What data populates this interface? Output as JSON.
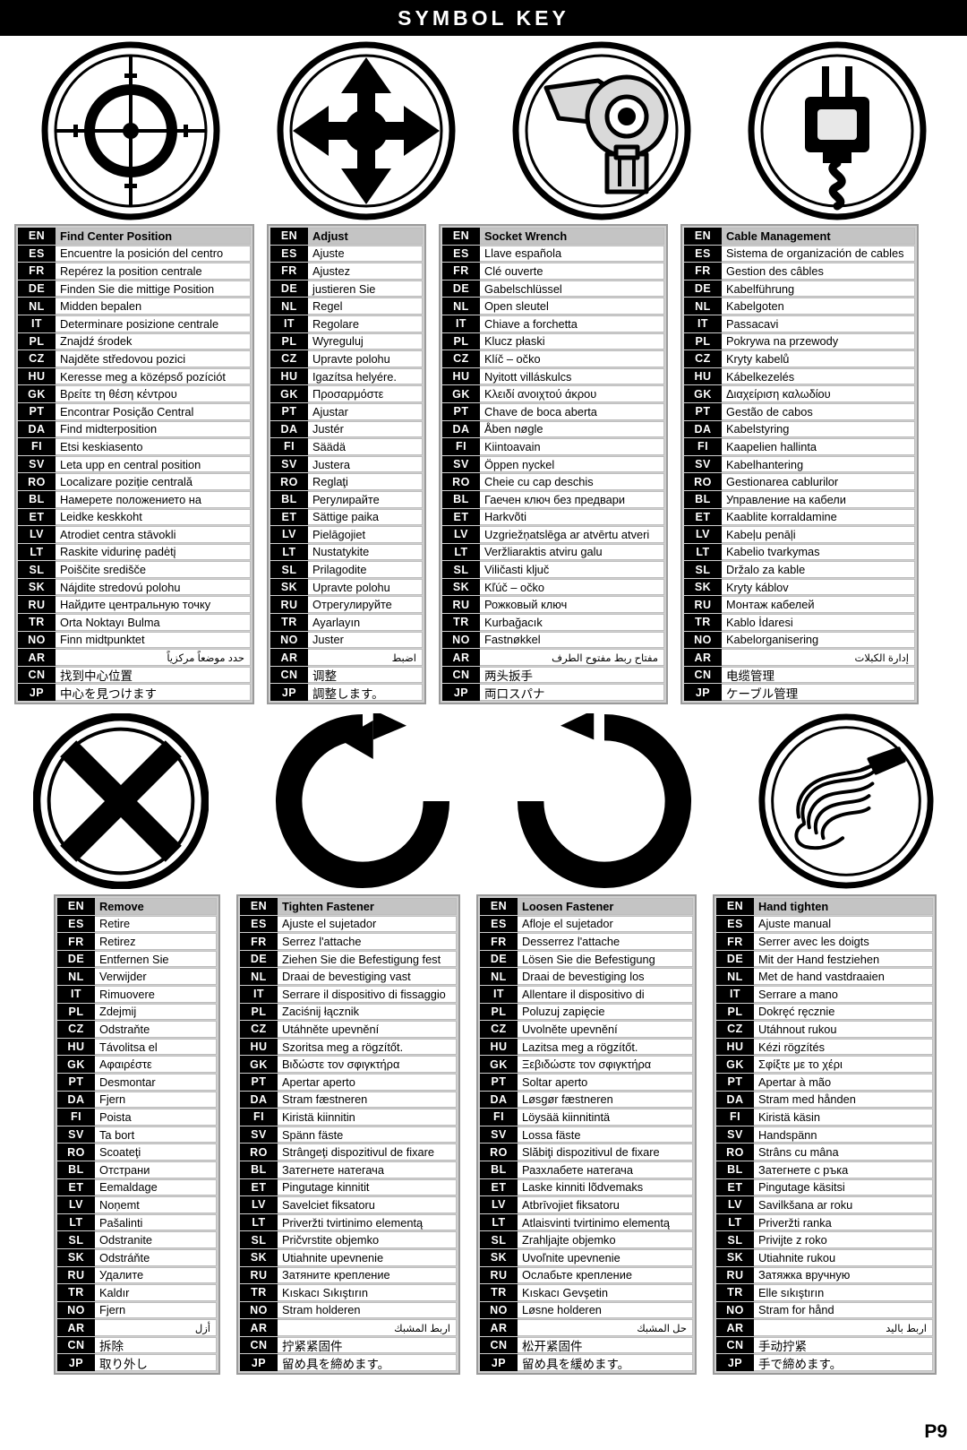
{
  "header": {
    "title": "SYMBOL KEY"
  },
  "page_number": "P9",
  "symbols_top": [
    {
      "name": "find-center-position-symbol",
      "icon": "crosshair-target-icon"
    },
    {
      "name": "adjust-symbol",
      "icon": "four-way-arrows-icon"
    },
    {
      "name": "socket-wrench-symbol",
      "icon": "ratchet-wrench-icon"
    },
    {
      "name": "cable-management-symbol",
      "icon": "power-plug-icon"
    }
  ],
  "symbols_bottom": [
    {
      "name": "remove-symbol",
      "icon": "x-cross-icon"
    },
    {
      "name": "tighten-fastener-symbol",
      "icon": "clockwise-arrow-icon"
    },
    {
      "name": "loosen-fastener-symbol",
      "icon": "counterclockwise-arrow-icon"
    },
    {
      "name": "hand-tighten-symbol",
      "icon": "hand-screwdriver-icon"
    }
  ],
  "tables_top": [
    {
      "id": "find-center-position",
      "rows": [
        {
          "code": "EN",
          "text": "Find Center Position"
        },
        {
          "code": "ES",
          "text": "Encuentre la posición del centro"
        },
        {
          "code": "FR",
          "text": "Repérez la position centrale"
        },
        {
          "code": "DE",
          "text": "Finden Sie die mittige Position"
        },
        {
          "code": "NL",
          "text": "Midden bepalen"
        },
        {
          "code": "IT",
          "text": "Determinare posizione centrale"
        },
        {
          "code": "PL",
          "text": "Znajdź środek"
        },
        {
          "code": "CZ",
          "text": "Najděte středovou pozici"
        },
        {
          "code": "HU",
          "text": "Keresse meg a középső pozíciót"
        },
        {
          "code": "GK",
          "text": "Βρείτε τη θέση κέντρου"
        },
        {
          "code": "PT",
          "text": "Encontrar Posição Central"
        },
        {
          "code": "DA",
          "text": "Find midterposition"
        },
        {
          "code": "FI",
          "text": "Etsi keskiasento"
        },
        {
          "code": "SV",
          "text": "Leta upp en central position"
        },
        {
          "code": "RO",
          "text": " Localizare poziție centrală"
        },
        {
          "code": "BL",
          "text": "Намерете положението на"
        },
        {
          "code": "ET",
          "text": "Leidke keskkoht"
        },
        {
          "code": "LV",
          "text": "Atrodiet centra stāvokli"
        },
        {
          "code": "LT",
          "text": "Raskite vidurinę padėtį"
        },
        {
          "code": "SL",
          "text": "Poiščite središče"
        },
        {
          "code": "SK",
          "text": "Nájdite stredovú polohu"
        },
        {
          "code": "RU",
          "text": "Найдите центральную точку"
        },
        {
          "code": "TR",
          "text": "Orta Noktayı Bulma"
        },
        {
          "code": "NO",
          "text": "Finn midtpunktet"
        },
        {
          "code": "AR",
          "text": "حدد موضعاً مركزياً"
        },
        {
          "code": "CN",
          "text": "找到中心位置"
        },
        {
          "code": "JP",
          "text": "中心を見つけます"
        }
      ]
    },
    {
      "id": "adjust",
      "rows": [
        {
          "code": "EN",
          "text": "Adjust"
        },
        {
          "code": "ES",
          "text": "Ajuste"
        },
        {
          "code": "FR",
          "text": "Ajustez"
        },
        {
          "code": "DE",
          "text": "justieren Sie"
        },
        {
          "code": "NL",
          "text": "Regel"
        },
        {
          "code": "IT",
          "text": "Regolare"
        },
        {
          "code": "PL",
          "text": "Wyreguluj"
        },
        {
          "code": "CZ",
          "text": "Upravte polohu"
        },
        {
          "code": "HU",
          "text": "Igazítsa helyére."
        },
        {
          "code": "GK",
          "text": "Προσαρμόστε"
        },
        {
          "code": "PT",
          "text": "Ajustar"
        },
        {
          "code": "DA",
          "text": "Justér"
        },
        {
          "code": "FI",
          "text": "Säädä"
        },
        {
          "code": "SV",
          "text": "Justera"
        },
        {
          "code": "RO",
          "text": "Reglaţi"
        },
        {
          "code": "BL",
          "text": "Регулирайте"
        },
        {
          "code": "ET",
          "text": "Sättige paika"
        },
        {
          "code": "LV",
          "text": "Pielāgojiet"
        },
        {
          "code": "LT",
          "text": "Nustatykite"
        },
        {
          "code": "SL",
          "text": "Prilagodite"
        },
        {
          "code": "SK",
          "text": "Upravte polohu"
        },
        {
          "code": "RU",
          "text": "Отрегулируйте"
        },
        {
          "code": "TR",
          "text": "Ayarlayın"
        },
        {
          "code": "NO",
          "text": "Juster"
        },
        {
          "code": "AR",
          "text": "اضبط"
        },
        {
          "code": "CN",
          "text": "调整"
        },
        {
          "code": "JP",
          "text": "調整します。"
        }
      ]
    },
    {
      "id": "socket-wrench",
      "rows": [
        {
          "code": "EN",
          "text": "Socket Wrench"
        },
        {
          "code": "ES",
          "text": "Llave española"
        },
        {
          "code": "FR",
          "text": "Clé ouverte"
        },
        {
          "code": "DE",
          "text": "Gabelschlüssel"
        },
        {
          "code": "NL",
          "text": "Open sleutel"
        },
        {
          "code": "IT",
          "text": "Chiave a forchetta"
        },
        {
          "code": "PL",
          "text": "Klucz płaski"
        },
        {
          "code": "CZ",
          "text": "Klíč – očko"
        },
        {
          "code": "HU",
          "text": "Nyitott villáskulcs"
        },
        {
          "code": "GK",
          "text": "Κλειδί ανοιχτού άκρου"
        },
        {
          "code": "PT",
          "text": "Chave de boca aberta"
        },
        {
          "code": "DA",
          "text": "Åben nøgle"
        },
        {
          "code": "FI",
          "text": "Kiintoavain"
        },
        {
          "code": "SV",
          "text": "Öppen nyckel"
        },
        {
          "code": "RO",
          "text": "Cheie cu cap deschis"
        },
        {
          "code": "BL",
          "text": "Гаечен ключ без предвари"
        },
        {
          "code": "ET",
          "text": "Harkvõti"
        },
        {
          "code": "LV",
          "text": "Uzgriežņatslēga ar atvērtu atveri"
        },
        {
          "code": "LT",
          "text": "Veržliaraktis atviru galu"
        },
        {
          "code": "SL",
          "text": "Viličasti ključ"
        },
        {
          "code": "SK",
          "text": "Kľúč – očko"
        },
        {
          "code": "RU",
          "text": "Рожковый ключ"
        },
        {
          "code": "TR",
          "text": "Kurbağacık"
        },
        {
          "code": "NO",
          "text": "Fastnøkkel"
        },
        {
          "code": "AR",
          "text": "مفتاح ربط مفتوح الطرف"
        },
        {
          "code": "CN",
          "text": "两头扳手"
        },
        {
          "code": "JP",
          "text": "両口スパナ"
        }
      ]
    },
    {
      "id": "cable-management",
      "rows": [
        {
          "code": "EN",
          "text": "Cable Management"
        },
        {
          "code": "ES",
          "text": "Sistema de organización de cables"
        },
        {
          "code": "FR",
          "text": "Gestion des câbles"
        },
        {
          "code": "DE",
          "text": "Kabelführung"
        },
        {
          "code": "NL",
          "text": "Kabelgoten"
        },
        {
          "code": "IT",
          "text": "Passacavi"
        },
        {
          "code": "PL",
          "text": "Pokrywa na przewody"
        },
        {
          "code": "CZ",
          "text": "Kryty kabelů"
        },
        {
          "code": "HU",
          "text": "Kábelkezelés"
        },
        {
          "code": "GK",
          "text": "Διαχείριση καλωδίου"
        },
        {
          "code": "PT",
          "text": "Gestão de cabos"
        },
        {
          "code": "DA",
          "text": "Kabelstyring"
        },
        {
          "code": "FI",
          "text": "Kaapelien hallinta"
        },
        {
          "code": "SV",
          "text": "Kabelhantering"
        },
        {
          "code": "RO",
          "text": "Gestionarea cablurilor"
        },
        {
          "code": "BL",
          "text": "Управление на кабели"
        },
        {
          "code": "ET",
          "text": "Kaablite korraldamine"
        },
        {
          "code": "LV",
          "text": "Kabeļu penāļi"
        },
        {
          "code": "LT",
          "text": "Kabelio tvarkymas"
        },
        {
          "code": "SL",
          "text": "Držalo za kable"
        },
        {
          "code": "SK",
          "text": "Kryty káblov"
        },
        {
          "code": "RU",
          "text": "Монтаж кабелей"
        },
        {
          "code": "TR",
          "text": "Kablo İdaresi"
        },
        {
          "code": "NO",
          "text": "Kabelorganisering"
        },
        {
          "code": "AR",
          "text": "إدارة الكبلات"
        },
        {
          "code": "CN",
          "text": "电缆管理"
        },
        {
          "code": "JP",
          "text": "ケーブル管理"
        }
      ]
    }
  ],
  "tables_bottom": [
    {
      "id": "remove",
      "rows": [
        {
          "code": "EN",
          "text": "Remove"
        },
        {
          "code": "ES",
          "text": "Retire"
        },
        {
          "code": "FR",
          "text": "Retirez"
        },
        {
          "code": "DE",
          "text": "Entfernen Sie"
        },
        {
          "code": "NL",
          "text": "Verwijder"
        },
        {
          "code": "IT",
          "text": "Rimuovere"
        },
        {
          "code": "PL",
          "text": "Zdejmij"
        },
        {
          "code": "CZ",
          "text": "Odstraňte"
        },
        {
          "code": "HU",
          "text": "Távolitsa el"
        },
        {
          "code": "GK",
          "text": "Αφαιρέστε"
        },
        {
          "code": "PT",
          "text": "Desmontar"
        },
        {
          "code": "DA",
          "text": "Fjern"
        },
        {
          "code": "FI",
          "text": "Poista"
        },
        {
          "code": "SV",
          "text": "Ta bort"
        },
        {
          "code": "RO",
          "text": "Scoateţi"
        },
        {
          "code": "BL",
          "text": "Отстрани"
        },
        {
          "code": "ET",
          "text": "Eemaldage"
        },
        {
          "code": "LV",
          "text": "Noņemt"
        },
        {
          "code": "LT",
          "text": "Pašalinti"
        },
        {
          "code": "SL",
          "text": "Odstranite"
        },
        {
          "code": "SK",
          "text": "Odstráňte"
        },
        {
          "code": "RU",
          "text": "Удалите"
        },
        {
          "code": "TR",
          "text": "Kaldır"
        },
        {
          "code": "NO",
          "text": "Fjern"
        },
        {
          "code": "AR",
          "text": "أزل"
        },
        {
          "code": "CN",
          "text": "拆除"
        },
        {
          "code": "JP",
          "text": "取り外し"
        }
      ]
    },
    {
      "id": "tighten-fastener",
      "rows": [
        {
          "code": "EN",
          "text": "Tighten Fastener"
        },
        {
          "code": "ES",
          "text": "Ajuste el sujetador"
        },
        {
          "code": "FR",
          "text": "Serrez l'attache"
        },
        {
          "code": "DE",
          "text": "Ziehen Sie die Befestigung fest"
        },
        {
          "code": "NL",
          "text": "Draai de bevestiging vast"
        },
        {
          "code": "IT",
          "text": "Serrare il dispositivo di fissaggio"
        },
        {
          "code": "PL",
          "text": "Zaciśnij łącznik"
        },
        {
          "code": "CZ",
          "text": "Utáhněte upevnění"
        },
        {
          "code": "HU",
          "text": "Szoritsa meg a rögzítőt."
        },
        {
          "code": "GK",
          "text": "Βιδώστε τον σφιγκτήρα"
        },
        {
          "code": "PT",
          "text": "Apertar aperto"
        },
        {
          "code": "DA",
          "text": "Stram fæstneren"
        },
        {
          "code": "FI",
          "text": "Kiristä kiinnitin"
        },
        {
          "code": "SV",
          "text": "Spänn fäste"
        },
        {
          "code": "RO",
          "text": "Strângeţi dispozitivul de fixare"
        },
        {
          "code": "BL",
          "text": "Затегнете натегача"
        },
        {
          "code": "ET",
          "text": "Pingutage kinnitit"
        },
        {
          "code": "LV",
          "text": "Savelciet fiksatoru"
        },
        {
          "code": "LT",
          "text": "Priveržti tvirtinimo elementą"
        },
        {
          "code": "SL",
          "text": "Pričvrstite objemko"
        },
        {
          "code": "SK",
          "text": "Utiahnite upevnenie"
        },
        {
          "code": "RU",
          "text": "Затяните крепление"
        },
        {
          "code": "TR",
          "text": "Kıskacı Sıkıştırın"
        },
        {
          "code": "NO",
          "text": "Stram holderen"
        },
        {
          "code": "AR",
          "text": "اربط المشبك"
        },
        {
          "code": "CN",
          "text": "拧紧紧固件"
        },
        {
          "code": "JP",
          "text": "留め具を締めます。"
        }
      ]
    },
    {
      "id": "loosen-fastener",
      "rows": [
        {
          "code": "EN",
          "text": "Loosen Fastener"
        },
        {
          "code": "ES",
          "text": "Afloje el sujetador"
        },
        {
          "code": "FR",
          "text": "Desserrez l'attache"
        },
        {
          "code": "DE",
          "text": "Lösen Sie die Befestigung"
        },
        {
          "code": "NL",
          "text": "Draai de bevestiging los"
        },
        {
          "code": "IT",
          "text": "Allentare il dispositivo di"
        },
        {
          "code": "PL",
          "text": "Poluzuj zapięcie"
        },
        {
          "code": "CZ",
          "text": "Uvolněte upevnění"
        },
        {
          "code": "HU",
          "text": "Lazitsa meg a rögzítőt."
        },
        {
          "code": "GK",
          "text": "Ξεβιδώστε τον σφιγκτήρα"
        },
        {
          "code": "PT",
          "text": "Soltar aperto"
        },
        {
          "code": "DA",
          "text": "Løsgør fæstneren"
        },
        {
          "code": "FI",
          "text": "Löysää kiinnitintä"
        },
        {
          "code": "SV",
          "text": "Lossa fäste"
        },
        {
          "code": "RO",
          "text": "Slăbiţi dispozitivul de fixare"
        },
        {
          "code": "BL",
          "text": "Разхлабете натегача"
        },
        {
          "code": "ET",
          "text": "Laske kinniti lõdvemaks"
        },
        {
          "code": "LV",
          "text": "Atbrīvojiet fiksatoru"
        },
        {
          "code": "LT",
          "text": "Atlaisvinti tvirtinimo elementą"
        },
        {
          "code": "SL",
          "text": "Zrahljajte objemko"
        },
        {
          "code": "SK",
          "text": "Uvoľnite upevnenie"
        },
        {
          "code": "RU",
          "text": "Ослабьте крепление"
        },
        {
          "code": "TR",
          "text": "Kıskacı Gevşetin"
        },
        {
          "code": "NO",
          "text": "Løsne holderen"
        },
        {
          "code": "AR",
          "text": "حل المشبك"
        },
        {
          "code": "CN",
          "text": "松开紧固件"
        },
        {
          "code": "JP",
          "text": "留め具を緩めます。"
        }
      ]
    },
    {
      "id": "hand-tighten",
      "rows": [
        {
          "code": "EN",
          "text": "Hand tighten"
        },
        {
          "code": "ES",
          "text": "Ajuste manual"
        },
        {
          "code": "FR",
          "text": "Serrer avec les doigts"
        },
        {
          "code": "DE",
          "text": "Mit der Hand festziehen"
        },
        {
          "code": "NL",
          "text": "Met de hand vastdraaien"
        },
        {
          "code": "IT",
          "text": "Serrare a mano"
        },
        {
          "code": "PL",
          "text": "Dokręć ręcznie"
        },
        {
          "code": "CZ",
          "text": "Utáhnout rukou"
        },
        {
          "code": "HU",
          "text": "Kézi rögzítés"
        },
        {
          "code": "GK",
          "text": "Σφίξτε με το χέρι"
        },
        {
          "code": "PT",
          "text": "Apertar à mão"
        },
        {
          "code": "DA",
          "text": "Stram med hånden"
        },
        {
          "code": "FI",
          "text": "Kiristä käsin"
        },
        {
          "code": "SV",
          "text": "Handspänn"
        },
        {
          "code": "RO",
          "text": "Strâns cu mâna"
        },
        {
          "code": "BL",
          "text": "Затегнете с ръка"
        },
        {
          "code": "ET",
          "text": "Pingutage käsitsi"
        },
        {
          "code": "LV",
          "text": "Savilkšana ar roku"
        },
        {
          "code": "LT",
          "text": "Priveržti ranka"
        },
        {
          "code": "SL",
          "text": "Privijte z roko"
        },
        {
          "code": "SK",
          "text": "Utiahnite rukou"
        },
        {
          "code": "RU",
          "text": "Затяжка вручную"
        },
        {
          "code": "TR",
          "text": "Elle sıkıştırın"
        },
        {
          "code": "NO",
          "text": "Stram for hånd"
        },
        {
          "code": "AR",
          "text": "اربط باليد"
        },
        {
          "code": "CN",
          "text": "手动拧紧"
        },
        {
          "code": "JP",
          "text": "手で締めます。"
        }
      ]
    }
  ]
}
